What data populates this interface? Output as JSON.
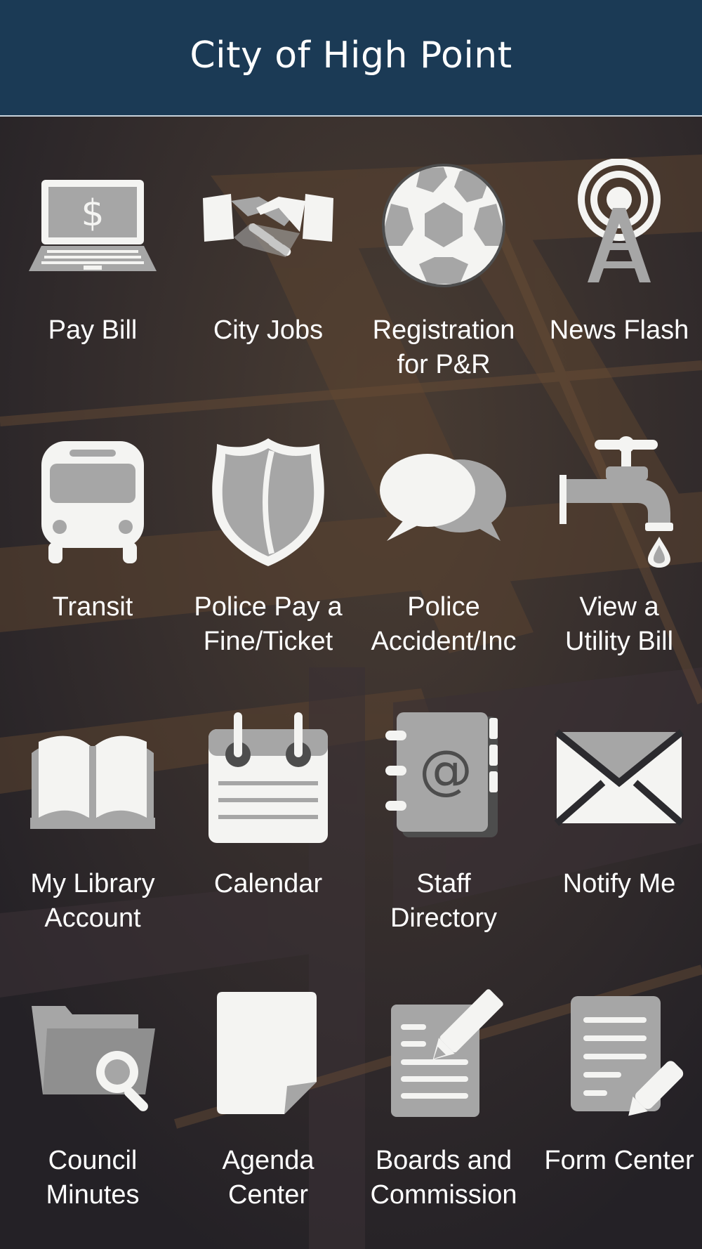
{
  "header": {
    "title": "City of High Point"
  },
  "colors": {
    "header_bg": "#1b3a55",
    "icon_light": "#f4f4f2",
    "icon_gray": "#a6a6a6",
    "label": "#ffffff"
  },
  "tiles": [
    {
      "icon": "laptop-dollar-icon",
      "line1": "Pay Bill",
      "line2": ""
    },
    {
      "icon": "handshake-icon",
      "line1": "City Jobs",
      "line2": ""
    },
    {
      "icon": "soccer-ball-icon",
      "line1": "Registration",
      "line2": "for P&R"
    },
    {
      "icon": "broadcast-tower-icon",
      "line1": "News Flash",
      "line2": ""
    },
    {
      "icon": "bus-icon",
      "line1": "Transit",
      "line2": ""
    },
    {
      "icon": "shield-icon",
      "line1": "Police Pay a",
      "line2": "Fine/Ticket"
    },
    {
      "icon": "speech-bubbles-icon",
      "line1": "Police",
      "line2": "Accident/Inc"
    },
    {
      "icon": "water-faucet-icon",
      "line1": "View a",
      "line2": "Utility Bill"
    },
    {
      "icon": "open-book-icon",
      "line1": "My Library",
      "line2": "Account"
    },
    {
      "icon": "calendar-icon",
      "line1": "Calendar",
      "line2": ""
    },
    {
      "icon": "address-book-icon",
      "line1": "Staff",
      "line2": "Directory"
    },
    {
      "icon": "envelope-icon",
      "line1": "Notify Me",
      "line2": ""
    },
    {
      "icon": "folder-search-icon",
      "line1": "Council",
      "line2": "Minutes"
    },
    {
      "icon": "document-page-icon",
      "line1": "Agenda",
      "line2": "Center"
    },
    {
      "icon": "document-pencil-icon",
      "line1": "Boards and",
      "line2": "Commission"
    },
    {
      "icon": "form-pen-icon",
      "line1": "Form Center",
      "line2": ""
    }
  ]
}
